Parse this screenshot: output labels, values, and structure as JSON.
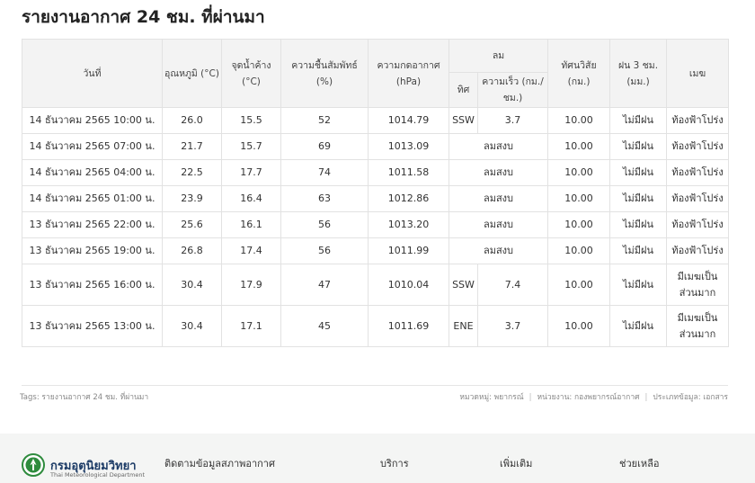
{
  "page": {
    "title": "รายงานอากาศ 24 ชม. ที่ผ่านมา"
  },
  "table": {
    "headers": {
      "date": "วันที่",
      "temp": "อุณหภูมิ (°C)",
      "dew": "จุดน้ำค้าง (°C)",
      "humidity": "ความชื้นสัมพัทธ์ (%)",
      "pressure": "ความกดอากาศ (hPa)",
      "wind": "ลม",
      "wind_dir": "ทิศ",
      "wind_speed": "ความเร็ว (กม./ชม.)",
      "visibility": "ทัศนวิสัย (กม.)",
      "rain": "ฝน 3 ชม. (มม.)",
      "cloud": "เมฆ"
    },
    "rows": [
      {
        "date": "14 ธันวาคม 2565 10:00 น.",
        "temp": "26.0",
        "dew": "15.5",
        "humidity": "52",
        "pressure": "1014.79",
        "wind_dir": "SSW",
        "wind_speed": "3.7",
        "wind_calm": "",
        "visibility": "10.00",
        "rain": "ไม่มีฝน",
        "cloud": "ท้องฟ้าโปร่ง"
      },
      {
        "date": "14 ธันวาคม 2565 07:00 น.",
        "temp": "21.7",
        "dew": "15.7",
        "humidity": "69",
        "pressure": "1013.09",
        "wind_dir": "",
        "wind_speed": "",
        "wind_calm": "ลมสงบ",
        "visibility": "10.00",
        "rain": "ไม่มีฝน",
        "cloud": "ท้องฟ้าโปร่ง"
      },
      {
        "date": "14 ธันวาคม 2565 04:00 น.",
        "temp": "22.5",
        "dew": "17.7",
        "humidity": "74",
        "pressure": "1011.58",
        "wind_dir": "",
        "wind_speed": "",
        "wind_calm": "ลมสงบ",
        "visibility": "10.00",
        "rain": "ไม่มีฝน",
        "cloud": "ท้องฟ้าโปร่ง"
      },
      {
        "date": "14 ธันวาคม 2565 01:00 น.",
        "temp": "23.9",
        "dew": "16.4",
        "humidity": "63",
        "pressure": "1012.86",
        "wind_dir": "",
        "wind_speed": "",
        "wind_calm": "ลมสงบ",
        "visibility": "10.00",
        "rain": "ไม่มีฝน",
        "cloud": "ท้องฟ้าโปร่ง"
      },
      {
        "date": "13 ธันวาคม 2565 22:00 น.",
        "temp": "25.6",
        "dew": "16.1",
        "humidity": "56",
        "pressure": "1013.20",
        "wind_dir": "",
        "wind_speed": "",
        "wind_calm": "ลมสงบ",
        "visibility": "10.00",
        "rain": "ไม่มีฝน",
        "cloud": "ท้องฟ้าโปร่ง"
      },
      {
        "date": "13 ธันวาคม 2565 19:00 น.",
        "temp": "26.8",
        "dew": "17.4",
        "humidity": "56",
        "pressure": "1011.99",
        "wind_dir": "",
        "wind_speed": "",
        "wind_calm": "ลมสงบ",
        "visibility": "10.00",
        "rain": "ไม่มีฝน",
        "cloud": "ท้องฟ้าโปร่ง"
      },
      {
        "date": "13 ธันวาคม 2565 16:00 น.",
        "temp": "30.4",
        "dew": "17.9",
        "humidity": "47",
        "pressure": "1010.04",
        "wind_dir": "SSW",
        "wind_speed": "7.4",
        "wind_calm": "",
        "visibility": "10.00",
        "rain": "ไม่มีฝน",
        "cloud": "มีเมฆเป็นส่วนมาก"
      },
      {
        "date": "13 ธันวาคม 2565 13:00 น.",
        "temp": "30.4",
        "dew": "17.1",
        "humidity": "45",
        "pressure": "1011.69",
        "wind_dir": "ENE",
        "wind_speed": "3.7",
        "wind_calm": "",
        "visibility": "10.00",
        "rain": "ไม่มีฝน",
        "cloud": "มีเมฆเป็นส่วนมาก"
      }
    ]
  },
  "tags": {
    "label": "Tags:",
    "value": "รายงานอากาศ 24 ชม. ที่ผ่านมา"
  },
  "meta": {
    "category": "หมวดหมู่: พยากรณ์",
    "agency": "หน่วยงาน: กองพยากรณ์อากาศ",
    "type": "ประเภทข้อมูล: เอกสาร"
  },
  "footer": {
    "org_name": "กรมอุตุนิยมวิทยา",
    "org_sub": "Thai Meteorological Department",
    "nav": [
      "ติดตามข้อมูลสภาพอากาศ",
      "บริการ",
      "เพิ่มเติม",
      "ช่วยเหลือ"
    ]
  },
  "colors": {
    "header_bg": "#f3f3f3",
    "border": "#e2e2e2",
    "footer_bg": "#f4f5f4",
    "brand": "#1c3b66",
    "logo_green": "#2e8b3d"
  }
}
